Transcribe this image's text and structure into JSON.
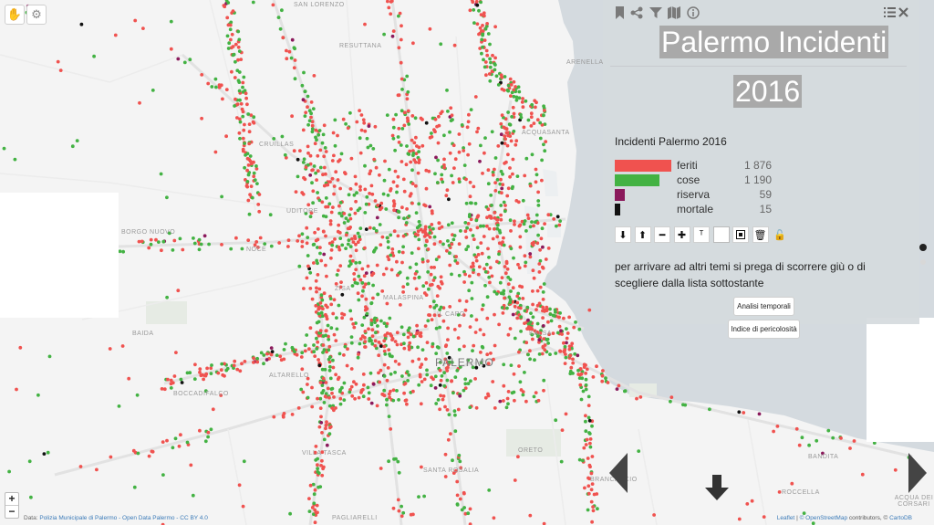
{
  "map": {
    "city_label": "PALERMO",
    "places": [
      {
        "name": "SAN LORENZO"
      },
      {
        "name": "RESUTTANA"
      },
      {
        "name": "ARENELLA"
      },
      {
        "name": "ACQUASANTA"
      },
      {
        "name": "CRUILLAS"
      },
      {
        "name": "UDITORE"
      },
      {
        "name": "BORGO NUOVO"
      },
      {
        "name": "NOCE"
      },
      {
        "name": "ZISA"
      },
      {
        "name": "MALASPINA"
      },
      {
        "name": "IL CAPO"
      },
      {
        "name": "KALSA"
      },
      {
        "name": "BAIDA"
      },
      {
        "name": "ALTARELLO"
      },
      {
        "name": "BOCCADIFALCO"
      },
      {
        "name": "VILLA TASCA"
      },
      {
        "name": "SANTA ROSALIA"
      },
      {
        "name": "PAGLIARELLI"
      },
      {
        "name": "BRANCACCIO"
      },
      {
        "name": "ROCCELLA"
      },
      {
        "name": "BANDITA"
      },
      {
        "name": "ACQUA DEI CORSARI"
      },
      {
        "name": "ORETO"
      }
    ],
    "incident_colors": {
      "feriti": "#f0524f",
      "cose": "#43b243",
      "riserva": "#8b1a5c",
      "mortale": "#111111"
    },
    "controls": {
      "locate_icon": "hand-locate-icon",
      "settings_icon": "gear-icon",
      "zoom_in": "+",
      "zoom_out": "−"
    },
    "attribution_left": {
      "prefix": "Data:",
      "source": "Polizia Municipale di Palermo - Open Data Palermo - CC BY 4.0"
    },
    "attribution_right": {
      "leaflet": "Leaflet",
      "sep": "|",
      "osm": "© OpenStreetMap",
      "contrib": "contributors, ©",
      "carto": "CartoDB"
    }
  },
  "panel": {
    "icons": [
      "bookmark-icon",
      "share-icon",
      "filter-icon",
      "map-icon",
      "info-icon",
      "list-icon",
      "close-icon"
    ],
    "title": "Palermo Incidenti",
    "year": "2016",
    "legend_title": "Incidenti Palermo 2016",
    "legend": [
      {
        "label": "feriti",
        "value": "1 876",
        "raw": 1876,
        "color": "#f0524f"
      },
      {
        "label": "cose",
        "value": "1 190",
        "raw": 1190,
        "color": "#43b243"
      },
      {
        "label": "riserva",
        "value": "59",
        "raw": 59,
        "color": "#8b1a5c"
      },
      {
        "label": "mortale",
        "value": "15",
        "raw": 15,
        "color": "#111111"
      }
    ],
    "tools": [
      "sort-down-icon",
      "sort-up-icon",
      "minus-icon",
      "plus-icon",
      "text-icon",
      "square-empty-icon",
      "square-full-icon",
      "trash-icon",
      "unlock-icon"
    ],
    "description": "per arrivare ad altri temi si prega di scorrere giù o di scegliere dalla lista sottostante",
    "buttons": {
      "analisi": "Analisi temporali",
      "indice": "Indice di pericolosità"
    }
  },
  "navigation": {
    "prev": "left-arrow-icon",
    "next": "right-arrow-icon",
    "down": "down-arrow-icon",
    "dots": 2,
    "active_dot": 0
  }
}
